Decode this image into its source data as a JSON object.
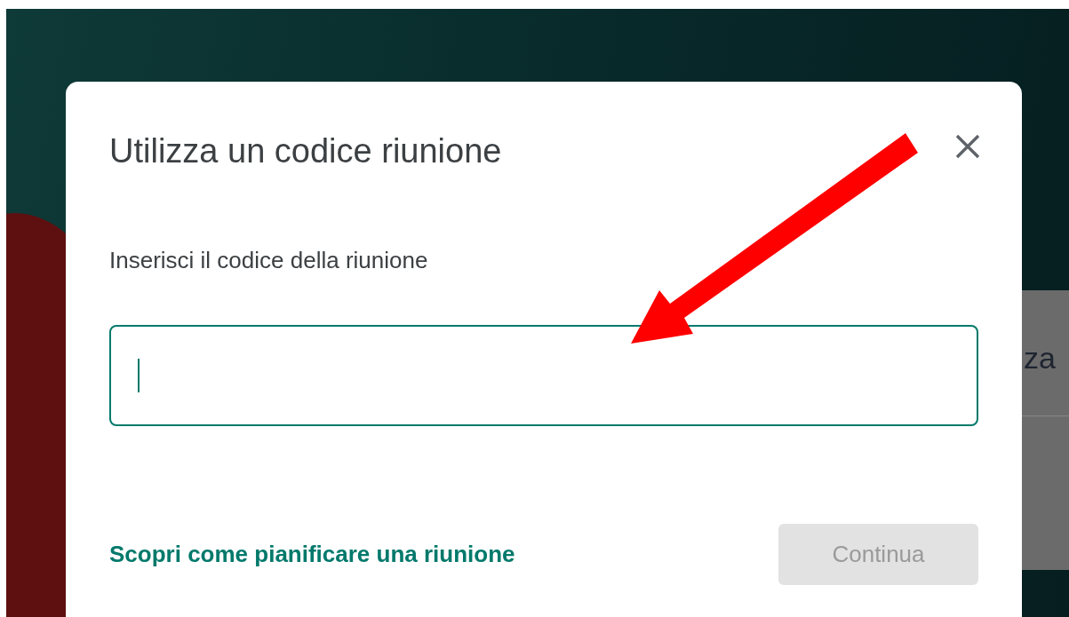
{
  "background": {
    "partial_text": "za"
  },
  "dialog": {
    "title": "Utilizza un codice riunione",
    "field_label": "Inserisci il codice della riunione",
    "code_field": {
      "focused": true
    },
    "help_link": "Scopri come pianificare una riunione",
    "continue_button": {
      "label": "Continua",
      "disabled": true
    }
  },
  "annotation": {
    "kind": "arrow"
  }
}
